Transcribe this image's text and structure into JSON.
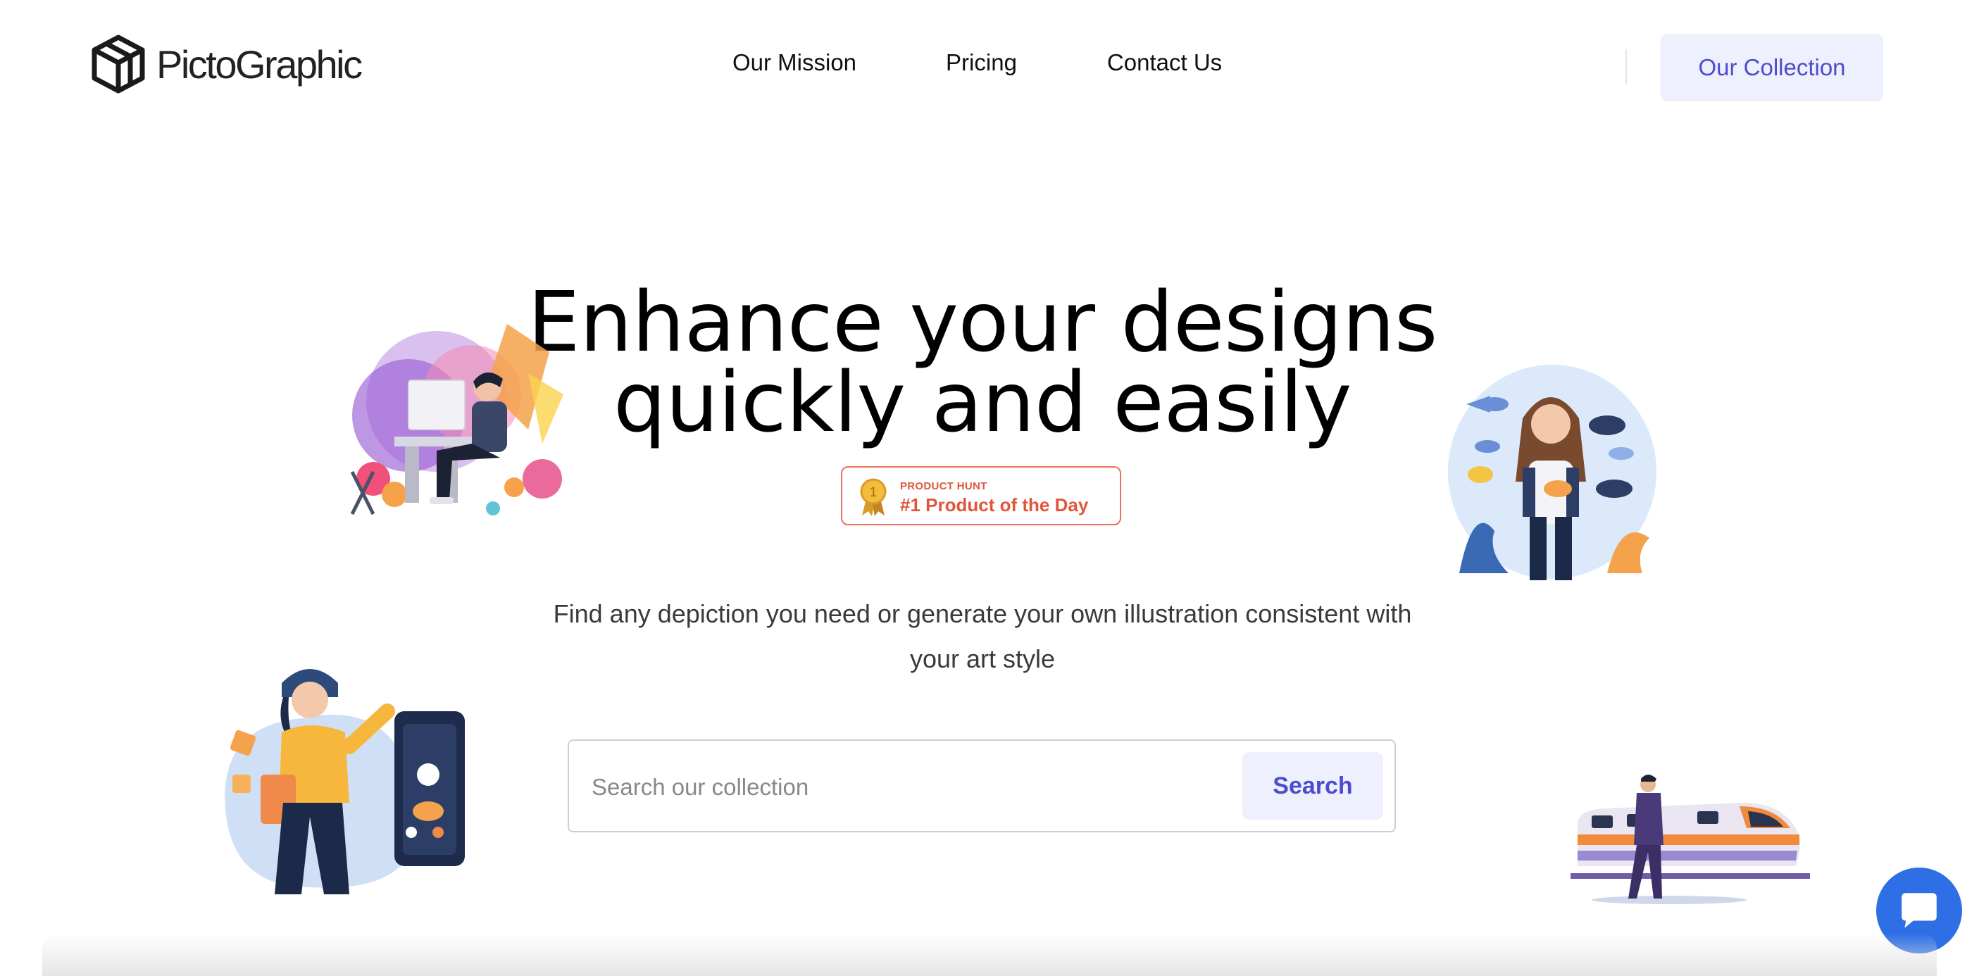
{
  "brand": {
    "name": "PictoGraphic",
    "logo_icon": "cube-logo-icon"
  },
  "nav": {
    "items": [
      {
        "label": "Our Mission"
      },
      {
        "label": "Pricing"
      },
      {
        "label": "Contact Us"
      }
    ],
    "cta_label": "Our Collection"
  },
  "hero": {
    "headline": "Enhance your designs quickly and easily",
    "badge": {
      "small": "PRODUCT HUNT",
      "big": "#1 Product of the Day",
      "icon": "medal-icon",
      "color": "#e0563d"
    },
    "subtext": "Find any depiction you need or generate your own illustration consistent with your art style"
  },
  "search": {
    "placeholder": "Search our collection",
    "button_label": "Search"
  },
  "illustrations": [
    {
      "name": "designer-at-computer-illustration"
    },
    {
      "name": "woman-with-fish-illustration"
    },
    {
      "name": "woman-with-phone-illustration"
    },
    {
      "name": "man-with-train-illustration"
    }
  ],
  "chat": {
    "icon": "chat-bubble-icon",
    "color": "#2f6fe6"
  },
  "colors": {
    "accent": "#4c4ccf",
    "accent_bg": "#eff0fd",
    "badge": "#e0563d",
    "text": "#111111"
  }
}
